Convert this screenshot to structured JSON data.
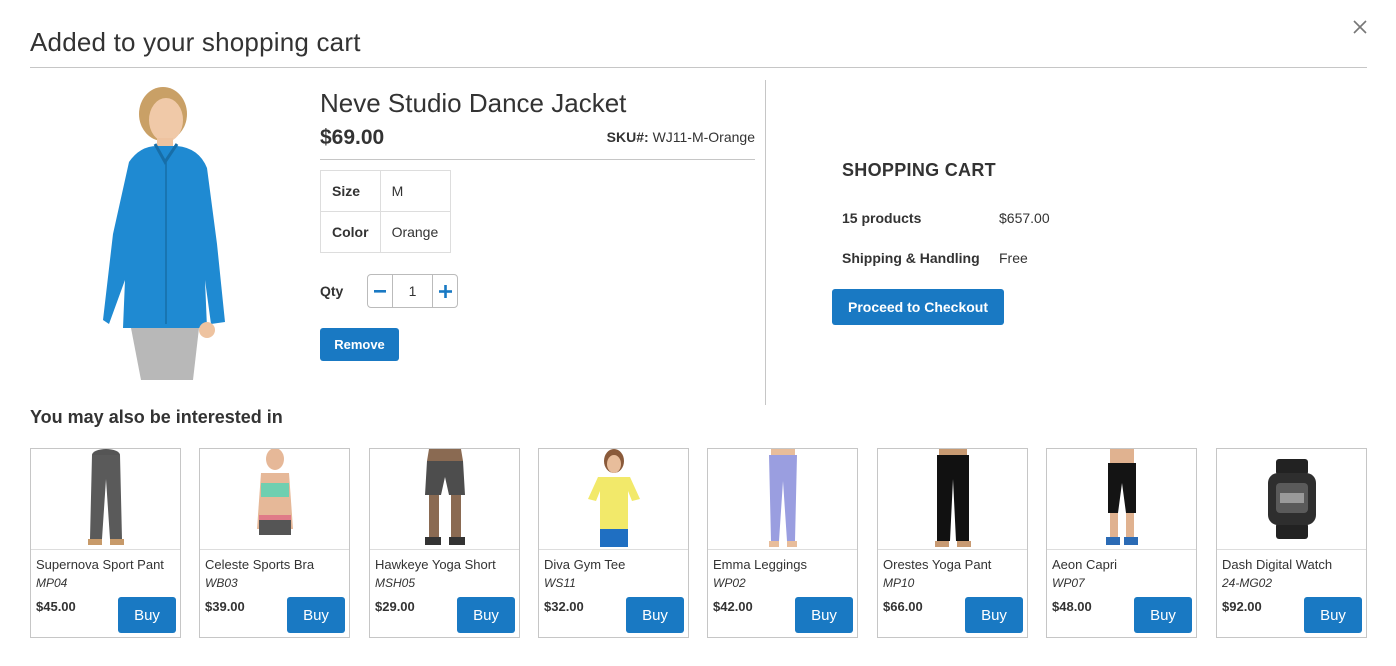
{
  "modal": {
    "title": "Added to your shopping cart"
  },
  "product": {
    "name": "Neve Studio Dance Jacket",
    "price": "$69.00",
    "sku_label": "SKU#:",
    "sku_value": "WJ11-M-Orange",
    "options": [
      {
        "label": "Size",
        "value": "M"
      },
      {
        "label": "Color",
        "value": "Orange"
      }
    ],
    "qty_label": "Qty",
    "qty_value": "1",
    "remove_label": "Remove",
    "image_icon": "woman-blue-jacket-image"
  },
  "cart": {
    "title": "SHOPPING CART",
    "products_label": "15 products",
    "products_total": "$657.00",
    "shipping_label": "Shipping & Handling",
    "shipping_value": "Free",
    "checkout_label": "Proceed to Checkout"
  },
  "related": {
    "title": "You may also be interested in",
    "buy_label": "Buy",
    "items": [
      {
        "name": "Supernova Sport Pant",
        "sku": "MP04",
        "price": "$45.00",
        "image": "grey-sport-pant-image"
      },
      {
        "name": "Celeste Sports Bra",
        "sku": "WB03",
        "price": "$39.00",
        "image": "sports-bra-image"
      },
      {
        "name": "Hawkeye Yoga Short",
        "sku": "MSH05",
        "price": "$29.00",
        "image": "yoga-short-image"
      },
      {
        "name": "Diva Gym Tee",
        "sku": "WS11",
        "price": "$32.00",
        "image": "yellow-tee-image"
      },
      {
        "name": "Emma Leggings",
        "sku": "WP02",
        "price": "$42.00",
        "image": "lavender-leggings-image"
      },
      {
        "name": "Orestes Yoga Pant",
        "sku": "MP10",
        "price": "$66.00",
        "image": "black-yoga-pant-image"
      },
      {
        "name": "Aeon Capri",
        "sku": "WP07",
        "price": "$48.00",
        "image": "capri-image"
      },
      {
        "name": "Dash Digital Watch",
        "sku": "24-MG02",
        "price": "$92.00",
        "image": "digital-watch-image"
      }
    ]
  },
  "colors": {
    "accent": "#1979c3",
    "border": "#c6c6c6",
    "text": "#333333"
  }
}
